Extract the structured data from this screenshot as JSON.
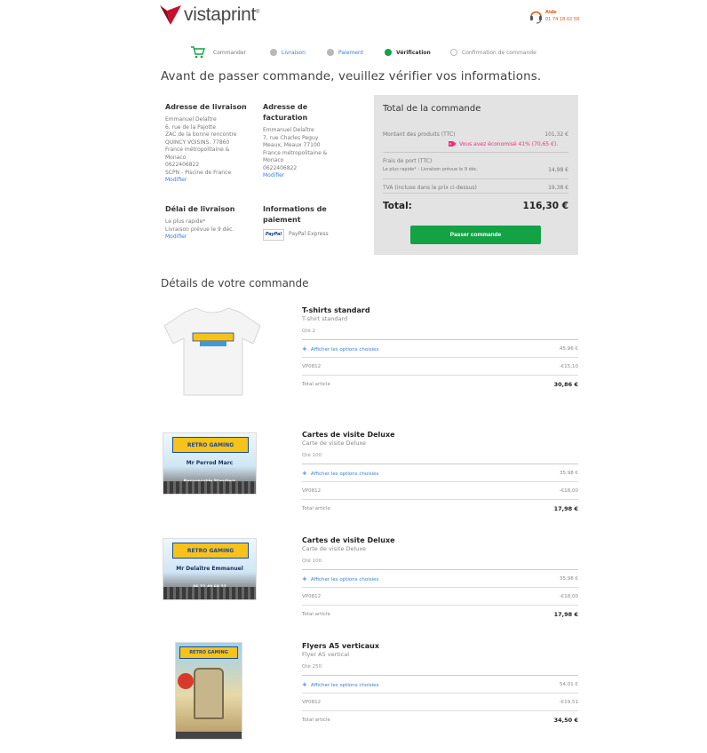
{
  "brand": {
    "name": "vistaprint",
    "trademark": "®",
    "accent": "#c8102e"
  },
  "help": {
    "label": "Aide",
    "phone": "01 74 18 02 58"
  },
  "steps": [
    {
      "label": "Commander",
      "state": "done"
    },
    {
      "label": "Livraison",
      "state": "done"
    },
    {
      "label": "Paiement",
      "state": "done"
    },
    {
      "label": "Vérification",
      "state": "active"
    },
    {
      "label": "Confirmation de commande",
      "state": "future"
    }
  ],
  "page_title": "Avant de passer commande, veuillez vérifier vos informations.",
  "delivery_address": {
    "heading": "Adresse de livraison",
    "lines": [
      "Emmanuel Delaître",
      "6, rue de la Pajotte",
      "ZAC de la bonne rencontre",
      "QUINCY VOISINS, 77860",
      "France métropolitaine &",
      "Monaco",
      "0622406822",
      "SCPN - Piscine de France"
    ],
    "edit": "Modifier"
  },
  "billing_address": {
    "heading": "Adresse de facturation",
    "lines": [
      "Emmanuel Delaître",
      "7, rue Charles Peguy",
      "Meaux, Meaux 77100",
      "France métropolitaine &",
      "Monaco",
      "0622406822"
    ],
    "edit": "Modifier"
  },
  "delivery_time": {
    "heading": "Délai de livraison",
    "lines": [
      "Le plus rapide*",
      "Livraison prévue le 9 déc."
    ],
    "edit": "Modifier"
  },
  "payment_info": {
    "heading": "Informations de paiement",
    "logo": "PayPal",
    "method": "PayPal Express"
  },
  "order_total": {
    "title": "Total de la commande",
    "products_label": "Montant des produits (TTC)",
    "products_value": "101,32 €",
    "savings": "Vous avez économisé 41% (70,65 €).",
    "shipping_label": "Frais de port (TTC)",
    "shipping_sub": "Le plus rapide* - Livraison prévue le 9 déc.",
    "shipping_value": "14,98 €",
    "tva_label": "TVA (incluse dans le prix ci-dessus)",
    "tva_value": "19,38 €",
    "total_label": "Total:",
    "total_value": "116,30 €",
    "button": "Passer commande"
  },
  "details_title": "Détails de votre commande",
  "items": [
    {
      "name": "T-shirts standard",
      "variant": "T-shirt standard",
      "qty": "Qté 2",
      "options": "Afficher les options choisies",
      "price": "45,96 €",
      "promo_code": "VP0812",
      "discount": "-€15,10",
      "total_label": "Total article",
      "total": "30,86 €",
      "image": "tshirt"
    },
    {
      "name": "Cartes de visite Deluxe",
      "variant": "Carte de visite Deluxe",
      "qty": "Qté 100",
      "options": "Afficher les options choisies",
      "price": "35,98 €",
      "promo_code": "VP0812",
      "discount": "-€18,00",
      "total_label": "Total article",
      "total": "17,98 €",
      "image": "card",
      "card_banner": "RETRO GAMING",
      "card_name": "Mr Perrod Marc",
      "card_sub": "Responsable Standiers"
    },
    {
      "name": "Cartes de visite Deluxe",
      "variant": "Carte de visite Deluxe",
      "qty": "Qté 100",
      "options": "Afficher les options choisies",
      "price": "35,98 €",
      "promo_code": "VP0812",
      "discount": "-€18,00",
      "total_label": "Total article",
      "total": "17,98 €",
      "image": "card",
      "card_banner": "RETRO GAMING",
      "card_name": "Mr Delaître Emmanuel",
      "card_sub": "06 22 40 68 22"
    },
    {
      "name": "Flyers A5 verticaux",
      "variant": "Flyer A5 vertical",
      "qty": "Qté 250",
      "options": "Afficher les options choisies",
      "price": "54,01 €",
      "promo_code": "VP0812",
      "discount": "-€19,51",
      "total_label": "Total article",
      "total": "34,50 €",
      "image": "flyer",
      "card_banner": "RETRO GAMING"
    }
  ]
}
